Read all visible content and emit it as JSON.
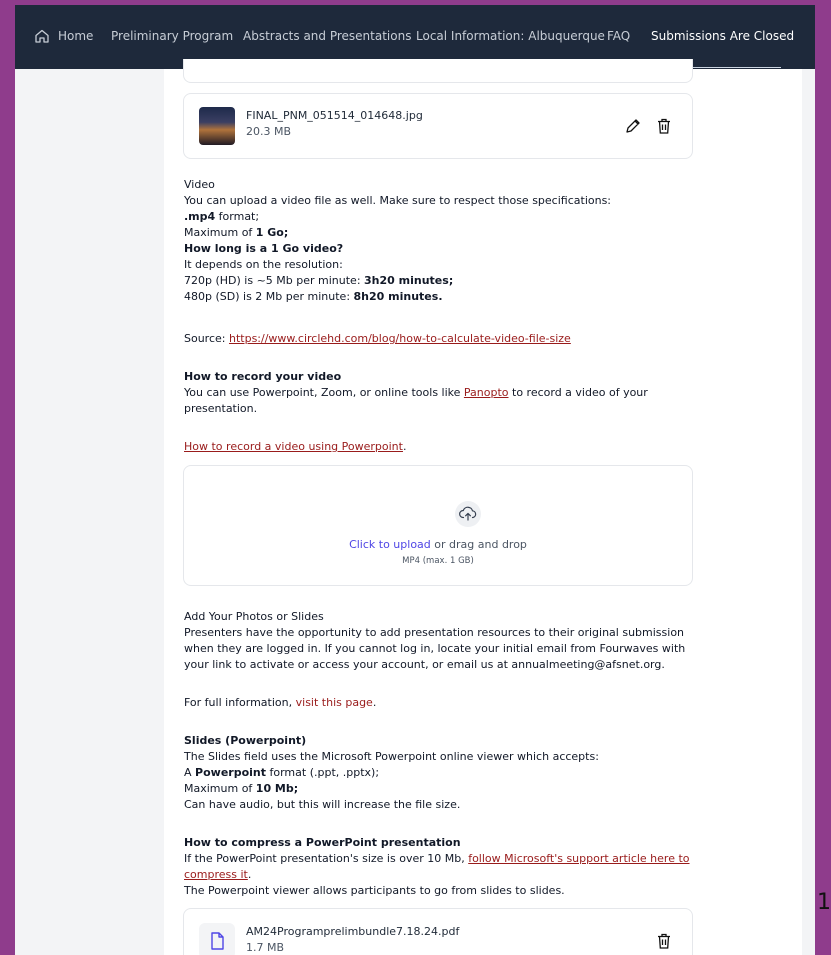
{
  "nav": {
    "items": [
      "Home",
      "Preliminary Program",
      "Abstracts and Presentations",
      "Local Information: Albuquerque",
      "FAQ",
      "Submissions Are Closed"
    ],
    "active_index": 5
  },
  "image_file": {
    "name": "FINAL_PNM_051514_014648.jpg",
    "size": "20.3 MB",
    "icons": [
      "pencil-icon",
      "trash-icon"
    ]
  },
  "video": {
    "heading": "Video",
    "intro": "You can upload a video file as well. Make sure to respect those specifications:",
    "format_bold": ".mp4",
    "format_rest": " format;",
    "max_prefix": "Maximum of ",
    "max_bold": "1 Go;",
    "q_bold": "How long is a 1 Go video?",
    "depends": "It depends on the resolution:",
    "hd_prefix": "720p (HD) is ~5 Mb per minute: ",
    "hd_bold": "3h20 minutes;",
    "sd_prefix": "480p (SD) is 2 Mb per minute: ",
    "sd_bold": "8h20 minutes.",
    "source_prefix": "Source: ",
    "source_link": "https://www.circlehd.com/blog/how-to-calculate-video-file-size"
  },
  "record": {
    "heading": "How to record your video",
    "line1_prefix": "You can use Powerpoint, Zoom, or online tools like ",
    "line1_link": "Panopto",
    "line1_suffix": " to record a video of your",
    "line2": "presentation.",
    "pp_link": "How to record a video using Powerpoint",
    "pp_suffix": "."
  },
  "upload": {
    "click_text": "Click to upload",
    "rest_text": " or drag and drop",
    "hint": "MP4 (max. 1 GB)",
    "icon": "cloud-upload-icon"
  },
  "photos": {
    "heading": "Add Your Photos or Slides",
    "line1": "Presenters have the opportunity to add presentation resources to their original submission",
    "line2": "when they are logged in. If you cannot log in, locate your initial email from Fourwaves with",
    "line3": "your link to activate or access your account, or email us at annualmeeting@afsnet.org.",
    "full_prefix": "For full information, ",
    "full_link": "visit this page",
    "full_suffix": "."
  },
  "slides": {
    "heading": "Slides (Powerpoint)",
    "line1": "The Slides field uses the Microsoft Powerpoint online viewer which accepts:",
    "fmt_prefix": "A ",
    "fmt_bold": "Powerpoint",
    "fmt_rest": " format (.ppt, .pptx);",
    "max_prefix": "Maximum of ",
    "max_bold": "10 Mb;",
    "audio": "Can have audio, but this will increase the file size."
  },
  "compress": {
    "heading": "How to compress a PowerPoint presentation",
    "line1_prefix": "If the PowerPoint presentation's size is over 10 Mb, ",
    "line1_link": "follow Microsoft's support article here to",
    "line2_link": "compress it",
    "line2_suffix": ".",
    "line3": "The Powerpoint viewer allows participants to go from slides to slides."
  },
  "pdf_file": {
    "name": "AM24Programprelimbundle7.18.24.pdf",
    "size": "1.7 MB",
    "icons": [
      "file-icon",
      "trash-icon"
    ]
  },
  "edge_text": "1"
}
